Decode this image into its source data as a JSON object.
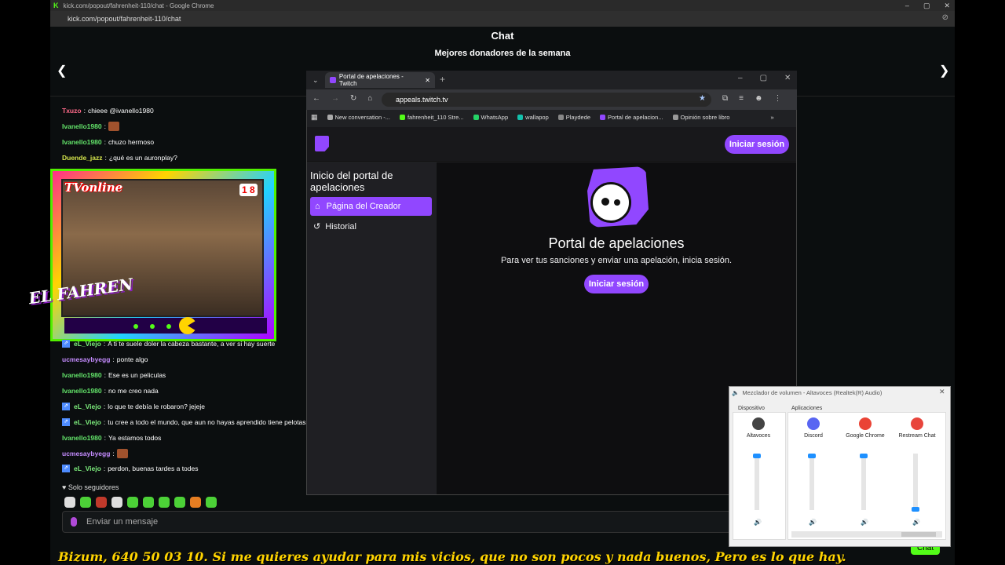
{
  "os_window": {
    "title": "kick.com/popout/fahrenheit-110/chat - Google Chrome",
    "address": "kick.com/popout/fahrenheit-110/chat",
    "controls": [
      "–",
      "▢",
      "✕"
    ]
  },
  "kick": {
    "chat_title": "Chat",
    "donors_title": "Mejores donadores de la semana",
    "messages_top": [
      {
        "user": "Txuzo",
        "color": "#ff6a8a",
        "text": "chieee @ivanello1980",
        "badge": false
      },
      {
        "user": "Ivanello1980",
        "color": "#63e46a",
        "text": "",
        "badge": false
      },
      {
        "user": "Ivanello1980",
        "color": "#63e46a",
        "text": "chuzo hermoso",
        "badge": false
      },
      {
        "user": "Duende_jazz",
        "color": "#d6e64d",
        "text": "¿qué es un auronplay?",
        "badge": false
      }
    ],
    "messages_bottom": [
      {
        "user": "eL_Viejo",
        "color": "#7ef07e",
        "text": "A ti te suele doler la cabeza bastante, a ver si hay suerte",
        "badge": true
      },
      {
        "user": "ucmesaybyegg",
        "color": "#c58cff",
        "text": "ponte algo",
        "badge": false
      },
      {
        "user": "Ivanello1980",
        "color": "#63e46a",
        "text": "Ese es un peliculas",
        "badge": false
      },
      {
        "user": "Ivanello1980",
        "color": "#63e46a",
        "text": "no me creo nada",
        "badge": false
      },
      {
        "user": "eL_Viejo",
        "color": "#7ef07e",
        "text": "lo que te debía le robaron? jejeje",
        "badge": true
      },
      {
        "user": "eL_Viejo",
        "color": "#7ef07e",
        "text": "tu cree a todo el mundo, que aun no hayas aprendido tiene pelotas",
        "badge": true
      },
      {
        "user": "Ivanello1980",
        "color": "#63e46a",
        "text": "Ya estamos todos",
        "badge": false
      },
      {
        "user": "ucmesaybyegg",
        "color": "#c58cff",
        "text": "",
        "badge": false
      },
      {
        "user": "eL_Viejo",
        "color": "#7ef07e",
        "text": "perdon, buenas tardes a todes",
        "badge": true
      }
    ],
    "followers_only": "Solo seguidores",
    "message_placeholder": "Enviar un mensaje",
    "chat_button": "Chat"
  },
  "overlay": {
    "tv_label": "TVonline",
    "score": "1 8",
    "brand": "EL FAHREN",
    "ticker": "Bizum, 640 50 03 10. Si me quieres ayudar para mis vicios, que no son pocos y nada buenos, Pero es lo que hay."
  },
  "browser": {
    "tab_title": "Portal de apelaciones - Twitch",
    "url": "appeals.twitch.tv",
    "bookmarks": [
      {
        "label": "New conversation -...",
        "color": "#aaaaaa"
      },
      {
        "label": "fahrenheit_110 Stre...",
        "color": "#53fc18"
      },
      {
        "label": "WhatsApp",
        "color": "#25d366"
      },
      {
        "label": "wallapop",
        "color": "#13c1ac"
      },
      {
        "label": "Playdede",
        "color": "#888888"
      },
      {
        "label": "Portal de apelacion...",
        "color": "#9147ff"
      },
      {
        "label": "Opinión sobre libro",
        "color": "#999999"
      }
    ]
  },
  "twitch": {
    "login_top": "Iniciar sesión",
    "sidebar_title": "Inicio del portal de apelaciones",
    "sidebar_items": [
      "Página del Creador",
      "Historial"
    ],
    "portal_title": "Portal de apelaciones",
    "portal_subtitle": "Para ver tus sanciones y enviar una apelación, inicia sesión.",
    "login_main": "Iniciar sesión",
    "accent": "#9147ff"
  },
  "mixer": {
    "title": "Mezclador de volumen - Altavoces (Realtek(R) Audio)",
    "device_label": "Dispositivo",
    "apps_label": "Aplicaciones",
    "channels": [
      {
        "name": "Altavoces",
        "level": 1.0,
        "icon_color": "#444444"
      },
      {
        "name": "Discord",
        "level": 1.0,
        "icon_color": "#5865f2"
      },
      {
        "name": "Google Chrome",
        "level": 1.0,
        "icon_color": "#ea4335"
      },
      {
        "name": "Restream Chat",
        "level": 0.0,
        "icon_color": "#e8453c"
      }
    ]
  }
}
